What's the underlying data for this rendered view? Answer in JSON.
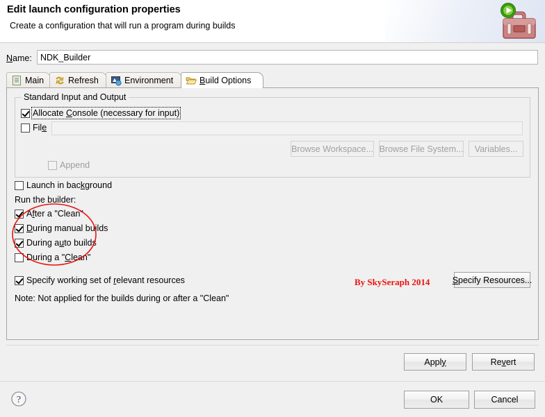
{
  "header": {
    "title": "Edit launch configuration properties",
    "subtitle": "Create a configuration that will run a program during builds",
    "icon": "toolbox-run-icon"
  },
  "name_field": {
    "label": "Name:",
    "label_mnemonic": "N",
    "value": "NDK_Builder",
    "placeholder": ""
  },
  "tabs": [
    {
      "label": "Main",
      "icon": "document-icon",
      "selected": false
    },
    {
      "label": "Refresh",
      "icon": "refresh-arrows-icon",
      "selected": false
    },
    {
      "label": "Environment",
      "icon": "environment-icon",
      "selected": false
    },
    {
      "label": "Build Options",
      "icon": "open-folder-icon",
      "selected": true
    }
  ],
  "build_options": {
    "group_title": "Standard Input and Output",
    "allocate_console": {
      "label": "Allocate Console (necessary for input)",
      "checked": true,
      "focused": true,
      "enabled": true
    },
    "file": {
      "label": "File",
      "checked": false,
      "enabled": true,
      "input_value": "",
      "input_enabled": false
    },
    "io_buttons": [
      {
        "label": "Browse Workspace...",
        "enabled": false
      },
      {
        "label": "Browse File System...",
        "enabled": false
      },
      {
        "label": "Variables...",
        "enabled": false
      }
    ],
    "append": {
      "label": "Append",
      "checked": false,
      "enabled": false
    },
    "launch_in_background": {
      "label": "Launch in background",
      "checked": false,
      "enabled": true
    },
    "run_builder_label": "Run the builder:",
    "run_builder_options": [
      {
        "label": "After a \"Clean\"",
        "checked": true
      },
      {
        "label": "During manual builds",
        "checked": true
      },
      {
        "label": "During auto builds",
        "checked": true
      },
      {
        "label": "During a \"Clean\"",
        "checked": false
      }
    ],
    "specify_working_set": {
      "label": "Specify working set of relevant resources",
      "checked": true
    },
    "specify_resources_button": "Specify Resources...",
    "note": "Note: Not applied for the builds during or after a \"Clean\""
  },
  "annotation": {
    "credit_text": "By SkySeraph 2014",
    "credit_color": "#e8130f",
    "ellipse_color": "#e8130f",
    "ellipse_name": "red-ellipse-highlight"
  },
  "footer": {
    "apply_label": "Apply",
    "revert_label": "Revert",
    "ok_label": "OK",
    "cancel_label": "Cancel",
    "help_icon": "help-question-icon"
  }
}
